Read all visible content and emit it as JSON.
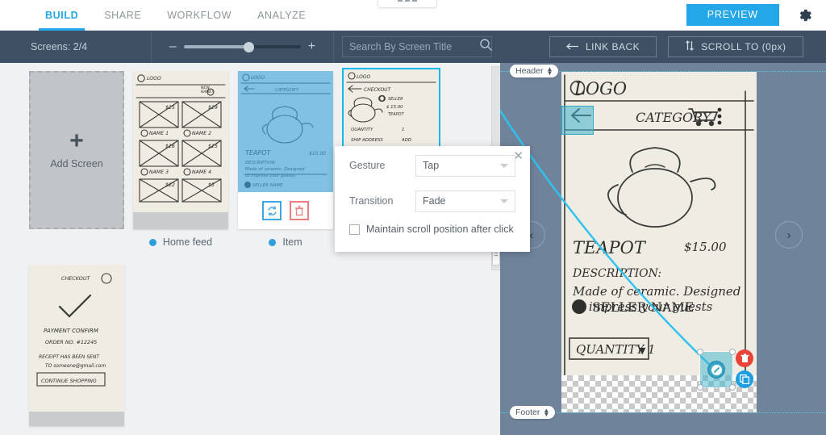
{
  "topnav": {
    "tabs": [
      {
        "label": "BUILD",
        "active": true
      },
      {
        "label": "SHARE",
        "active": false
      },
      {
        "label": "WORKFLOW",
        "active": false
      },
      {
        "label": "ANALYZE",
        "active": false
      }
    ],
    "preview_label": "PREVIEW",
    "gear_icon": "gear-icon",
    "dots_icon": "ellipsis-icon"
  },
  "toolbar": {
    "screens_count": "Screens: 2/4",
    "zoom_out": "–",
    "zoom_in": "+",
    "zoom_percent": 55,
    "search_placeholder": "Search By Screen Title",
    "search_value": "",
    "search_icon": "search-icon",
    "link_back_label": "LINK BACK",
    "link_back_icon": "arrow-left-icon",
    "scroll_to_label": "SCROLL TO (0px)",
    "scroll_to_icon": "updown-arrows-icon"
  },
  "screens": [
    {
      "kind": "add",
      "label": "Add Screen",
      "plus_icon": "plus-icon"
    },
    {
      "kind": "screen",
      "title": "Home feed",
      "selected": false,
      "highlighted": false,
      "sketch_text": {
        "logo": "LOGO",
        "account": "ACC NAME",
        "cells": [
          {
            "price": "$25",
            "name": "NAME 1"
          },
          {
            "price": "$19",
            "name": "NAME 2"
          },
          {
            "price": "$16",
            "name": "NAME 3"
          },
          {
            "price": "$15",
            "name": "NAME 4"
          },
          {
            "price": "$22",
            "name": ""
          },
          {
            "price": "$5",
            "name": ""
          }
        ]
      }
    },
    {
      "kind": "screen",
      "title": "Item",
      "selected": true,
      "highlighted": false,
      "replace_icon": "replace-icon",
      "delete_icon": "trash-icon",
      "sketch_text": {
        "logo": "LOGO",
        "category": "CATEGORY",
        "item_name": "TEAPOT",
        "price": "$15.00",
        "description_label": "DESCRIPTION:",
        "description": "Made of ceramic. Designed to impress your guests",
        "seller": "SELLER NAME"
      }
    },
    {
      "kind": "screen",
      "title": "",
      "selected": false,
      "highlighted": true,
      "sketch_text": {
        "logo": "LOGO",
        "checkout": "CHECKOUT",
        "seller": "SELLER",
        "price": "$15.00",
        "item_name": "TEAPOT",
        "quantity_label": "QUANTITY",
        "quantity_value": "1",
        "ship_label": "SHIP ADDRESS",
        "ship_value": "ADD"
      }
    },
    {
      "kind": "screen",
      "title": "",
      "selected": false,
      "highlighted": false,
      "sketch_text": {
        "checkout": "CHECKOUT",
        "confirm": "PAYMENT CONFIRM",
        "order": "ORDER NO. #12245",
        "receipt_1": "RECEIPT HAS BEEN SENT",
        "receipt_2": "TO someone@gmail.com",
        "cta": "CONTINUE SHOPPING",
        "check_icon": "checkmark-icon"
      }
    }
  ],
  "preview": {
    "header_pill": "Header",
    "footer_pill": "Footer",
    "prev_icon": "chevron-left-icon",
    "next_icon": "chevron-right-icon",
    "hotspot_icon": "link-hotspot-icon",
    "hotspot_delete_icon": "trash-icon",
    "hotspot_duplicate_icon": "copy-icon",
    "screen": {
      "logo": "LOGO",
      "category": "CATEGORY",
      "cart_icon": "cart-icon",
      "menu_icon": "kebab-menu-icon",
      "back_icon": "arrow-left-icon",
      "item_name": "TEAPOT",
      "price": "$15.00",
      "description_label": "DESCRIPTION:",
      "description_line1": "Made of ceramic. Designed",
      "description_line2": "to impress your guests",
      "seller": "SELLER  NAME",
      "quantity": "QUANTITY 1"
    }
  },
  "dialog": {
    "close_icon": "close-icon",
    "gesture_label": "Gesture",
    "gesture_value": "Tap",
    "transition_label": "Transition",
    "transition_value": "Fade",
    "checkbox_label": "Maintain scroll position after click",
    "checkbox_checked": false
  },
  "colors": {
    "accent": "#23a7e8",
    "toolbar_bg": "#3f5064",
    "preview_bg": "#6f839a",
    "hotspot": "#3aa8c9",
    "highlight": "#12b9e8",
    "danger": "#e8443a"
  }
}
